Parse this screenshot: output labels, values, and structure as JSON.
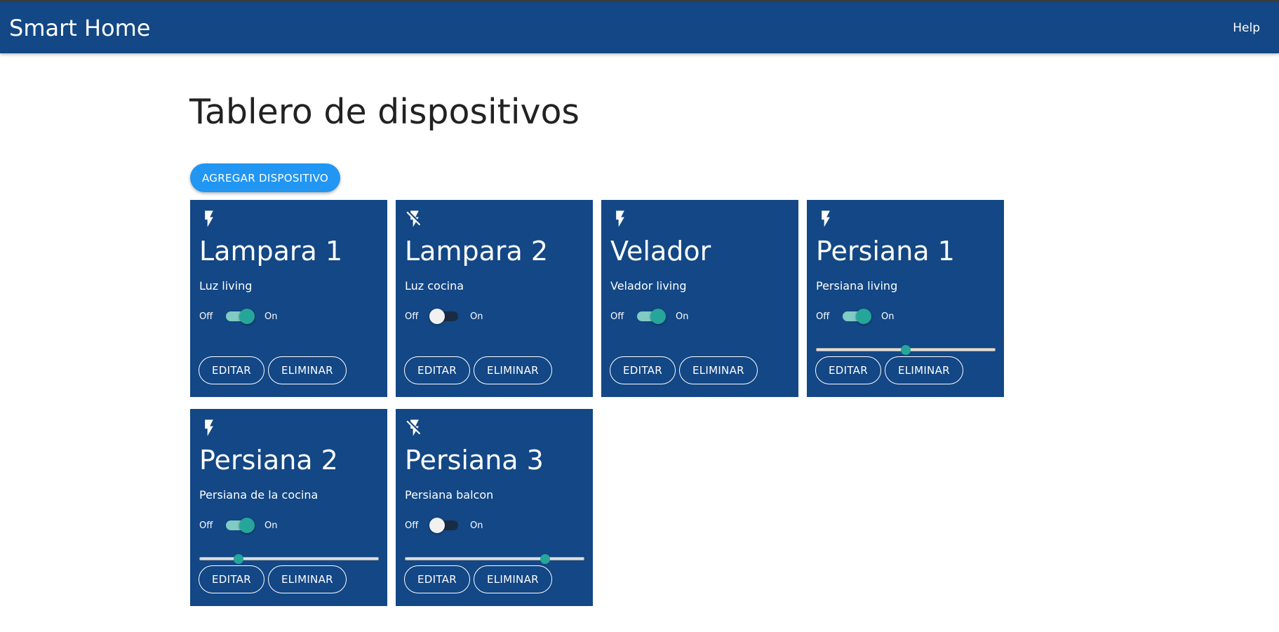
{
  "app": {
    "title": "Smart Home",
    "help_label": "Help"
  },
  "page": {
    "title": "Tablero de dispositivos",
    "add_button_label": "AGREGAR DISPOSITIVO"
  },
  "labels": {
    "off": "Off",
    "on": "On",
    "edit": "EDITAR",
    "delete": "ELIMINAR"
  },
  "colors": {
    "appbar": "#134785",
    "card": "#134785",
    "accent": "#2196f3",
    "switch_on": "#26a69a"
  },
  "devices": [
    {
      "name": "Lampara 1",
      "description": "Luz living",
      "icon": "flash-on-icon",
      "state": "on",
      "level": null
    },
    {
      "name": "Lampara 2",
      "description": "Luz cocina",
      "icon": "flash-off-icon",
      "state": "off",
      "level": null
    },
    {
      "name": "Velador",
      "description": "Velador living",
      "icon": "flash-on-icon",
      "state": "on",
      "level": null
    },
    {
      "name": "Persiana 1",
      "description": "Persiana living",
      "icon": "flash-on-icon",
      "state": "on",
      "level": 50
    },
    {
      "name": "Persiana 2",
      "description": "Persiana de la cocina",
      "icon": "flash-on-icon",
      "state": "on",
      "level": 22
    },
    {
      "name": "Persiana 3",
      "description": "Persiana balcon",
      "icon": "flash-off-icon",
      "state": "off",
      "level": 78
    }
  ]
}
